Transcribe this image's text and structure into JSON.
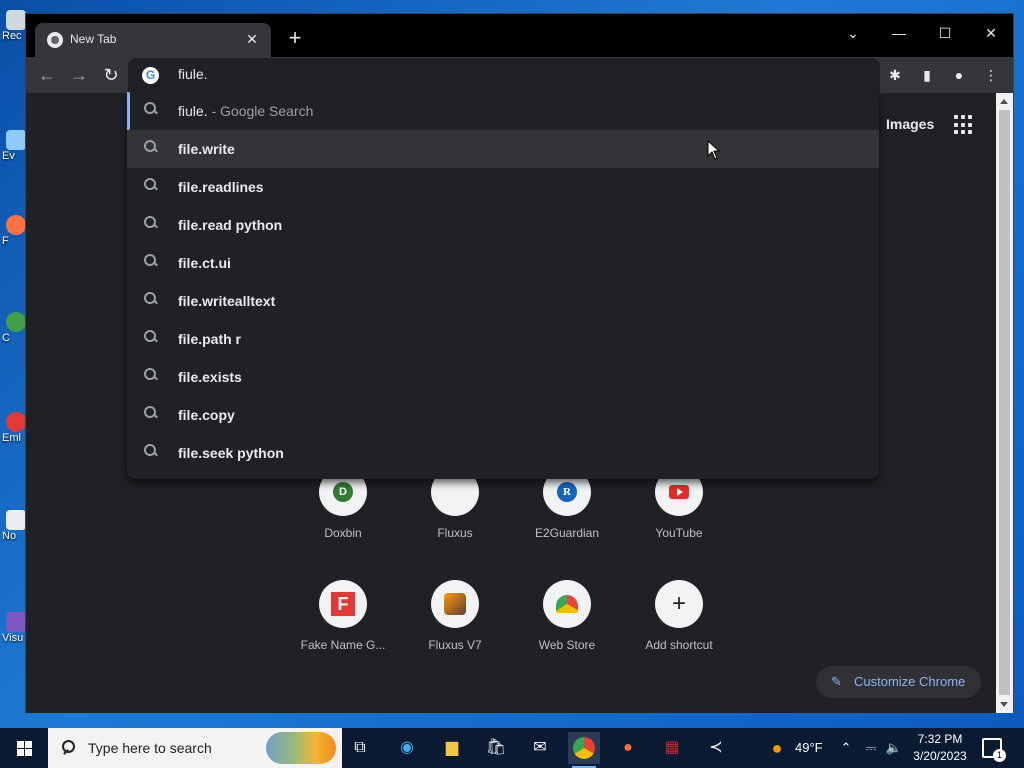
{
  "desktop": {
    "icons": [
      {
        "label": "Rec"
      },
      {
        "label": "Ev"
      },
      {
        "label": "F"
      },
      {
        "label": "C"
      },
      {
        "label": "Eml"
      },
      {
        "label": "No"
      },
      {
        "label": "Visu"
      }
    ]
  },
  "browser": {
    "tab": {
      "title": "New Tab",
      "close": "✕"
    },
    "new_tab": "+",
    "window_controls": {
      "dropdown": "⌄",
      "minimize": "—",
      "maximize": "☐",
      "close": "✕"
    },
    "omnibox": {
      "value": "fiule."
    },
    "suggestions": [
      {
        "text": "fiule.",
        "suffix": " - Google Search"
      },
      {
        "bold": "file.write"
      },
      {
        "bold": "file.readlines"
      },
      {
        "bold": "file.read python"
      },
      {
        "bold": "file.ct.ui"
      },
      {
        "bold": "file.writealltext"
      },
      {
        "bold": "file.path r"
      },
      {
        "bold": "file.exists"
      },
      {
        "bold": "file.copy"
      },
      {
        "bold": "file.seek python"
      }
    ],
    "header": {
      "images_label": "Images"
    },
    "shortcuts": [
      {
        "label": "Doxbin",
        "glyph": "D"
      },
      {
        "label": "Fluxus"
      },
      {
        "label": "E2Guardian",
        "glyph": "R"
      },
      {
        "label": "YouTube"
      },
      {
        "label": "Fake Name G...",
        "glyph": "F"
      },
      {
        "label": "Fluxus V7"
      },
      {
        "label": "Web Store"
      },
      {
        "label": "Add shortcut",
        "glyph": "+"
      }
    ],
    "customize_label": "Customize Chrome"
  },
  "taskbar": {
    "search_placeholder": "Type here to search",
    "weather": "49°F",
    "time": "7:32 PM",
    "date": "3/20/2023",
    "notification_count": "1"
  }
}
